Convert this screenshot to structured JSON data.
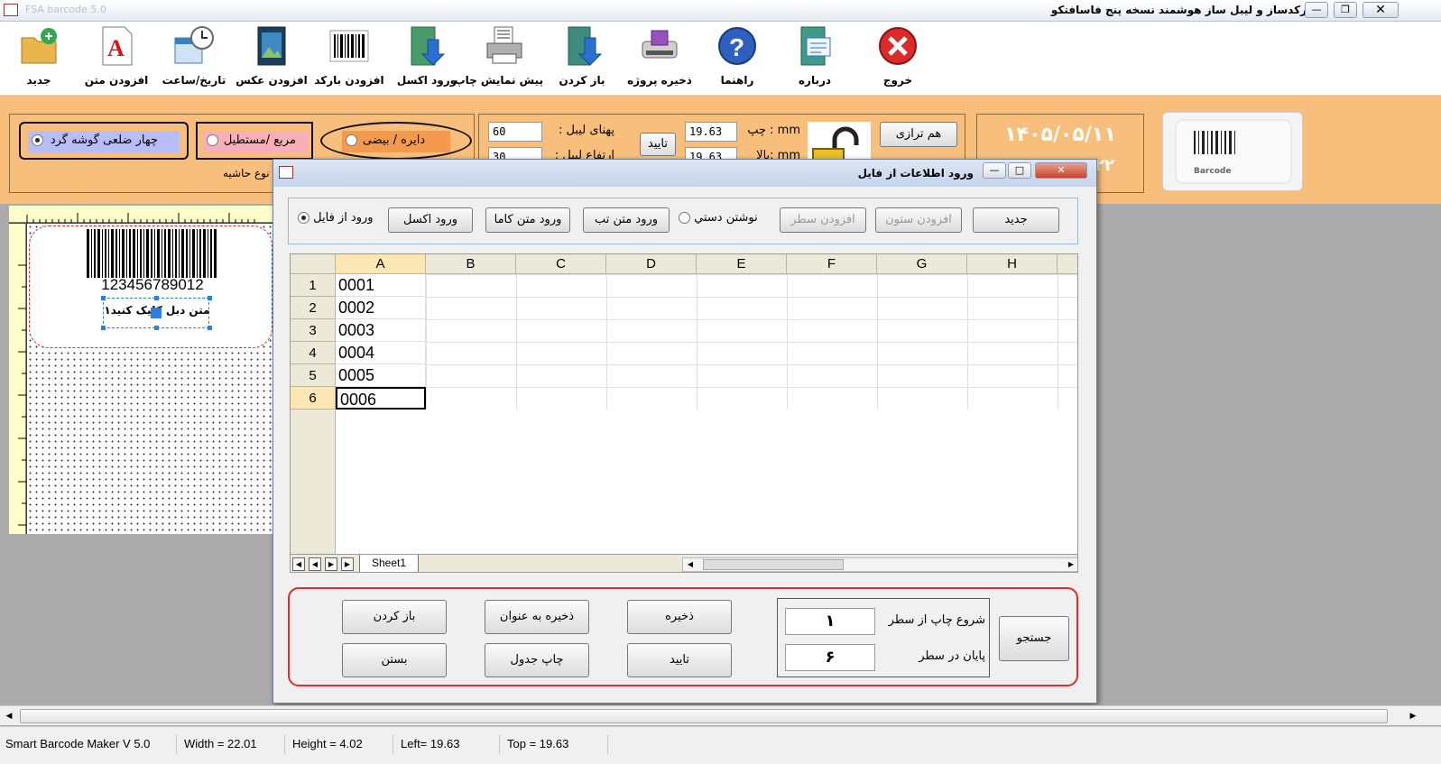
{
  "window": {
    "title": "بارکدساز و لیبل ساز هوشمند نسخه پنج فاسافتکو",
    "faded_title": "FSA barcode 5.0"
  },
  "toolbar": {
    "items": [
      {
        "label": "جدید",
        "icon": "new-folder-icon"
      },
      {
        "label": "افزودن متن",
        "icon": "text-A-icon"
      },
      {
        "label": "تاریخ/ساعت",
        "icon": "calendar-clock-icon"
      },
      {
        "label": "افزودن عکس",
        "icon": "picture-icon"
      },
      {
        "label": "افزودن بارکد",
        "icon": "barcode-icon"
      },
      {
        "label": "ورود اکسل",
        "icon": "import-excel-icon"
      },
      {
        "label": "پیش نمایش چاپ",
        "icon": "printer-icon"
      },
      {
        "label": "باز کردن",
        "icon": "open-icon"
      },
      {
        "label": "ذخیره پروژه",
        "icon": "save-disk-icon"
      },
      {
        "label": "راهنما",
        "icon": "help-icon"
      },
      {
        "label": "درباره",
        "icon": "about-icon"
      },
      {
        "label": "خروج",
        "icon": "exit-icon"
      }
    ]
  },
  "shape": {
    "option1": "چهار ضلعی گوشه گرد",
    "option2": "مربع /مستطیل",
    "option3": "دایره / بیضی",
    "group_label": "نوع حاشیه",
    "selected": "option1"
  },
  "size": {
    "width_label": "پهنای لیبل :",
    "width_value": "60",
    "height_label": "ارتفاع لیبل :",
    "height_value": "30",
    "confirm": "تایید",
    "left_label": "چپ : mm",
    "left_value": "19.63",
    "top_label": "بالا: mm",
    "top_value": "19.63",
    "align_button": "هم ترازی"
  },
  "date": {
    "value": "۱۴۰۵/۰۵/۱۱",
    "time": "۲۲"
  },
  "logo": {
    "text": "Barcode"
  },
  "label_preview": {
    "barcode_number": "123456789012",
    "text": "متن دبل کلیک کنید۱"
  },
  "dialog": {
    "title": "ورود اطلاعات از فایل",
    "source_radio": "ورود از فایل",
    "excel_btn": "ورود اکسل",
    "comma_btn": "ورود متن کاما",
    "tab_btn": "ورود متن تب",
    "manual_radio": "نوشتن دستي",
    "add_row": "افزودن سطر",
    "add_col": "افزودن ستون",
    "new_btn": "جدید",
    "columns": [
      "A",
      "B",
      "C",
      "D",
      "E",
      "F",
      "G",
      "H"
    ],
    "rows": [
      {
        "n": "1",
        "a": "0001"
      },
      {
        "n": "2",
        "a": "0002"
      },
      {
        "n": "3",
        "a": "0003"
      },
      {
        "n": "4",
        "a": "0004"
      },
      {
        "n": "5",
        "a": "0005"
      },
      {
        "n": "6",
        "a": "0006"
      }
    ],
    "sheet_tab": "Sheet1",
    "open_btn": "باز کردن",
    "saveas_btn": "ذخیره به عنوان",
    "save_btn": "ذخیره",
    "close_btn": "بستن",
    "printtable_btn": "چاپ جدول",
    "ok_btn": "تایید",
    "start_label": "شروع چاپ از سطر",
    "start_value": "۱",
    "end_label": "پایان در سطر",
    "end_value": "۶",
    "search_btn": "جستجو"
  },
  "status": {
    "app": "Smart Barcode Maker V 5.0",
    "width": "Width = 22.01",
    "height": "Height = 4.02",
    "left": "Left= 19.63",
    "top": "Top = 19.63"
  },
  "colors": {
    "toolbar_bg": "#ffffff",
    "panel_orange": "#f8bf7c",
    "accent_red": "#e8282a"
  }
}
